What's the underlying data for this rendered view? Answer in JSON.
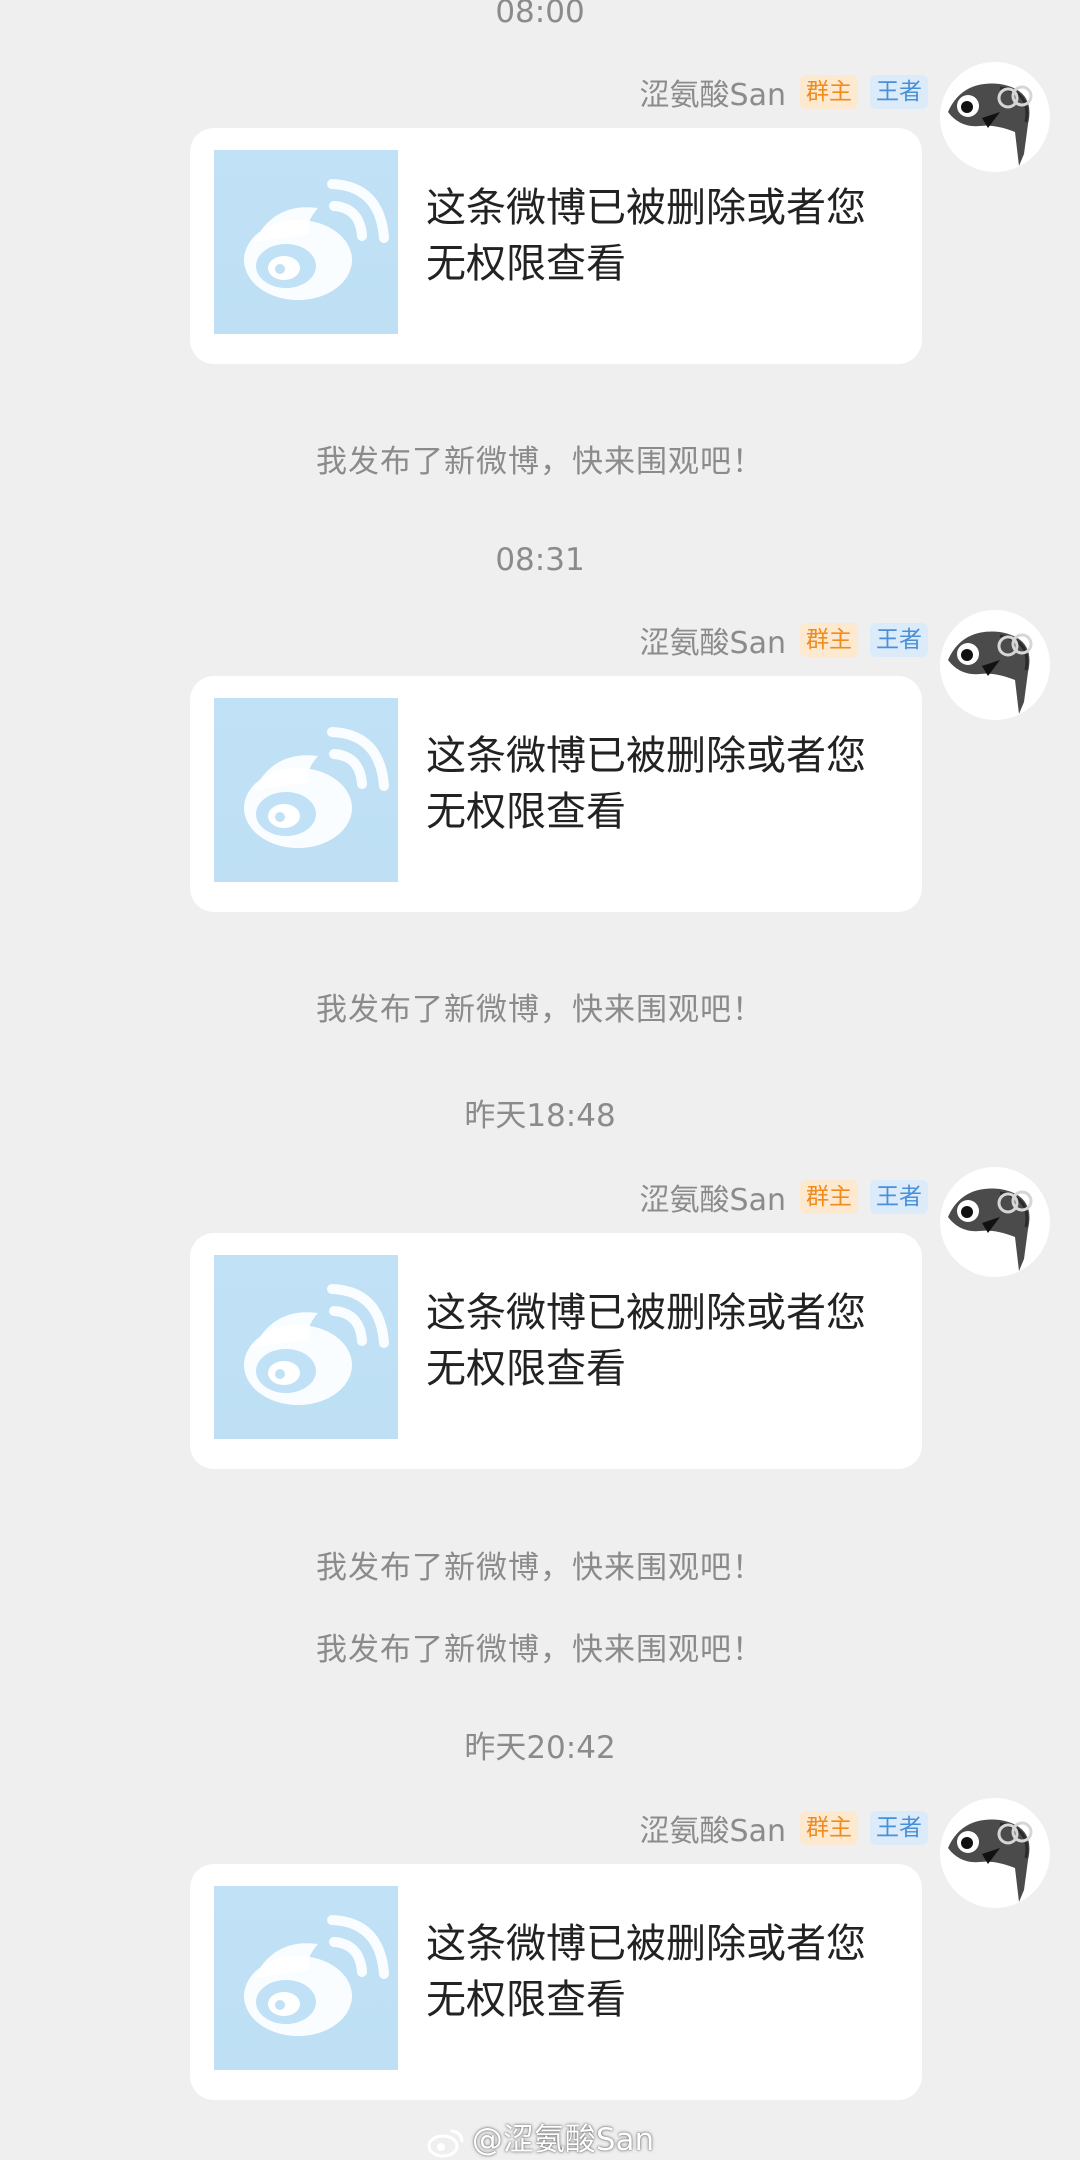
{
  "messages": [
    {
      "time": "08:00",
      "sender": "涩氨酸San",
      "badges": [
        "群主",
        "王者"
      ],
      "card_text": "这条微博已被删除或者您无权限查看",
      "notices": [
        "我发布了新微博，快来围观吧！"
      ]
    },
    {
      "time": "08:31",
      "sender": "涩氨酸San",
      "badges": [
        "群主",
        "王者"
      ],
      "card_text": "这条微博已被删除或者您无权限查看",
      "notices": [
        "我发布了新微博，快来围观吧！"
      ]
    },
    {
      "time": "昨天18:48",
      "sender": "涩氨酸San",
      "badges": [
        "群主",
        "王者"
      ],
      "card_text": "这条微博已被删除或者您无权限查看",
      "notices": [
        "我发布了新微博，快来围观吧！",
        "我发布了新微博，快来围观吧！"
      ]
    },
    {
      "time": "昨天20:42",
      "sender": "涩氨酸San",
      "badges": [
        "群主",
        "王者"
      ],
      "card_text": "这条微博已被删除或者您无权限查看",
      "notices": []
    }
  ],
  "watermark": "@涩氨酸San",
  "icons": {
    "thumbnail": "weibo-logo-icon",
    "avatar": "penguin-avatar-icon",
    "watermark": "weibo-logo-icon"
  },
  "colors": {
    "background": "#efefef",
    "bubble": "#ffffff",
    "badge_owner": "#f08c1e",
    "badge_level": "#4a90d9",
    "thumbnail": "#c0e1f6"
  }
}
